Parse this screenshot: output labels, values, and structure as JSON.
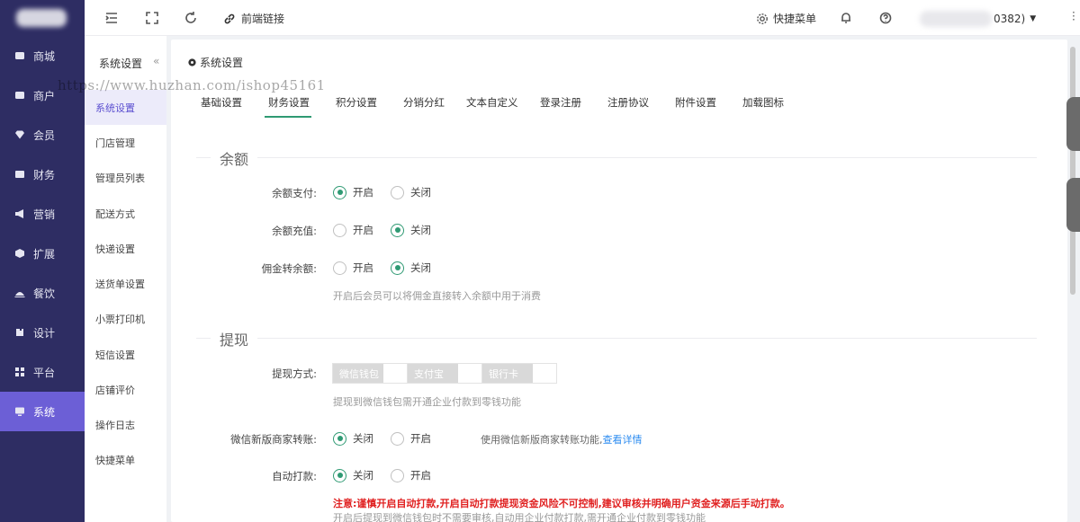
{
  "sidebar": {
    "items": [
      {
        "label": "商城",
        "icon": "shop-icon"
      },
      {
        "label": "商户",
        "icon": "merchant-icon"
      },
      {
        "label": "会员",
        "icon": "member-icon"
      },
      {
        "label": "财务",
        "icon": "finance-icon"
      },
      {
        "label": "营销",
        "icon": "megaphone-icon"
      },
      {
        "label": "扩展",
        "icon": "extension-icon"
      },
      {
        "label": "餐饮",
        "icon": "dining-icon"
      },
      {
        "label": "设计",
        "icon": "design-icon"
      },
      {
        "label": "平台",
        "icon": "grid-icon"
      },
      {
        "label": "系统",
        "icon": "system-icon"
      }
    ],
    "active_index": 9
  },
  "topbar": {
    "frontend_link": "前端链接",
    "quick_menu": "快捷菜单",
    "user_suffix": "0382)"
  },
  "submenu": {
    "title": "系统设置",
    "collapse": "«",
    "items": [
      "系统设置",
      "门店管理",
      "管理员列表",
      "配送方式",
      "快递设置",
      "送货单设置",
      "小票打印机",
      "短信设置",
      "店铺评价",
      "操作日志",
      "快捷菜单"
    ]
  },
  "watermark": "https://www.huzhan.com/ishop45161",
  "main": {
    "title": "系统设置",
    "tabs": [
      "基础设置",
      "财务设置",
      "积分设置",
      "分销分红",
      "文本自定义",
      "登录注册",
      "注册协议",
      "附件设置",
      "加载图标"
    ],
    "active_tab": 1,
    "balance": {
      "section": "余额",
      "pay_label": "余额支付:",
      "recharge_label": "余额充值:",
      "commission_label": "佣金转余额:",
      "open": "开启",
      "close": "关闭",
      "commission_hint": "开启后会员可以将佣金直接转入余额中用于消费"
    },
    "withdraw": {
      "section": "提现",
      "method_label": "提现方式:",
      "methods": [
        "微信钱包",
        "支付宝",
        "银行卡"
      ],
      "method_hint": "提现到微信钱包需开通企业付款到零钱功能",
      "wechat_transfer_label": "微信新版商家转账:",
      "wechat_transfer_hint": "使用微信新版商家转账功能,",
      "view_details": "查看详情",
      "auto_pay_label": "自动打款:",
      "close": "关闭",
      "open": "开启",
      "warning": "注意:谨慎开启自动打款,开启自动打款提现资金风险不可控制,建议审核并明确用户资金来源后手动打款。",
      "auto_hint": "开启后提现到微信钱包时不需要审核,自动用企业付款打款,需开通企业付款到零钱功能"
    }
  },
  "colors": {
    "sidebar_bg": "#2e2d63",
    "sidebar_active": "#6c5fd6",
    "accent_green": "#2f9a73",
    "warning_red": "#e02020",
    "link_blue": "#2d8cf0"
  }
}
